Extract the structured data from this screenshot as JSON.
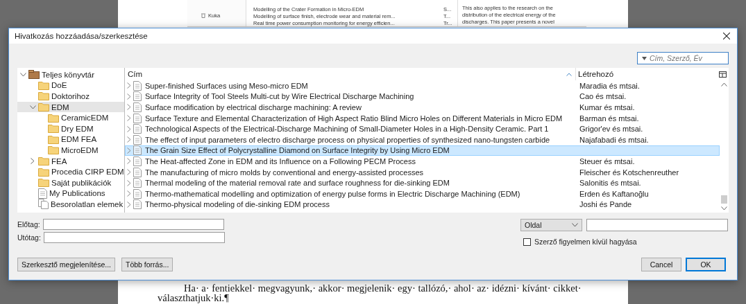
{
  "document": {
    "embedded_screenshot": {
      "sidebar_items": [
        {
          "label": "Kuka",
          "kind": "trash"
        }
      ],
      "rows": [
        {
          "title": "Modelling of the Crater Formation in Micro-EDM",
          "column_2": "S..."
        },
        {
          "title": "Modelling of surface finish, electrode wear and material rem...",
          "column_2": "T..."
        },
        {
          "title": "Real time power consumption monitoring for energy efficien...",
          "column_2": "Tr..."
        }
      ],
      "abstract_lines": [
        "This also applies to the research on the",
        "distribution of the electrical energy of the",
        "discharges. This paper presents a novel"
      ]
    },
    "paragraph_lines": [
      "Ha· a· fentiekkel· megvagyunk,· akkor· megjelenik· egy· tallózó,· ahol· az· idézni· kívánt· cikket·",
      "választhatjuk·ki.¶"
    ]
  },
  "dialog": {
    "title": "Hivatkozás hozzáadása/szerkesztése",
    "search": {
      "placeholder": "Cím, Szerző, Év"
    },
    "tree": [
      {
        "label": "Teljes könyvtár",
        "kind": "library",
        "expanded": true,
        "selected": false,
        "children": [
          {
            "label": "DoE",
            "kind": "folder",
            "selected": false
          },
          {
            "label": "Doktorihoz",
            "kind": "folder",
            "selected": false
          },
          {
            "label": "EDM",
            "kind": "folder",
            "expanded": true,
            "selected": true,
            "children": [
              {
                "label": "CeramicEDM",
                "kind": "folder",
                "selected": false
              },
              {
                "label": "Dry EDM",
                "kind": "folder",
                "selected": false
              },
              {
                "label": "EDM FEA",
                "kind": "folder",
                "selected": false
              },
              {
                "label": "MicroEDM",
                "kind": "folder",
                "selected": false
              }
            ]
          },
          {
            "label": "FEA",
            "kind": "folder",
            "expanded": false,
            "selected": false
          },
          {
            "label": "Procedia CIRP EDM",
            "kind": "folder",
            "selected": false
          },
          {
            "label": "Saját publikációk",
            "kind": "folder",
            "selected": false
          },
          {
            "label": "My Publications",
            "kind": "document",
            "selected": false
          },
          {
            "label": "Besorolatlan elemek",
            "kind": "unfiled",
            "selected": false
          }
        ]
      }
    ],
    "table": {
      "columns": [
        "Cím",
        "Létrehozó"
      ],
      "rows": [
        {
          "title": "Super-finished Surfaces using Meso-micro EDM",
          "creator": "Maradia és mtsai.",
          "selected": false
        },
        {
          "title": "Surface Integrity of Tool Steels Multi-cut by Wire Electrical Discharge Machining",
          "creator": "Cao és mtsai.",
          "selected": false
        },
        {
          "title": "Surface modification by electrical discharge machining: A review",
          "creator": "Kumar és mtsai.",
          "selected": false
        },
        {
          "title": "Surface Texture and Elemental Characterization of High Aspect Ratio Blind Micro Holes on Different Materials in Micro EDM",
          "creator": "Barman és mtsai.",
          "selected": false
        },
        {
          "title": "Technological Aspects of the Electrical-Discharge Machining of Small-Diameter Holes in a High-Density Ceramic. Part 1",
          "creator": "Grigor'ev és mtsai.",
          "selected": false
        },
        {
          "title": "The effect of input parameters of electro discharge process on physical properties of synthesized nano-tungsten carbide",
          "creator": "Najafabadi és mtsai.",
          "selected": false
        },
        {
          "title": "The Grain Size Effect of Polycrystalline Diamond on Surface Integrity by Using Micro EDM",
          "selected": true
        },
        {
          "title": "The Heat-affected Zone in EDM and its Influence on a Following PECM Process",
          "creator": "Steuer és mtsai.",
          "selected": false
        },
        {
          "title": "The manufacturing of micro molds by conventional and energy-assisted processes",
          "creator": "Fleischer és Kotschenreuther",
          "selected": false
        },
        {
          "title": "Thermal modeling of the material removal rate and surface roughness for die-sinking EDM",
          "creator": "Salonitis és mtsai.",
          "selected": false
        },
        {
          "title": "Thermo-mathematical modelling and optimization of energy pulse forms in Electric Discharge Machining (EDM)",
          "creator": "Erden és Kaftanoğlu",
          "selected": false
        },
        {
          "title": "Thermo-physical modeling of die-sinking EDM process",
          "creator": "Joshi és Pande",
          "selected": false
        }
      ]
    },
    "prefix": {
      "label": "Előtag:"
    },
    "suffix": {
      "label": "Utótag:"
    },
    "locator": {
      "value": "Oldal"
    },
    "omit_author": {
      "label": "Szerző figyelmen kívül hagyása",
      "checked": false
    },
    "buttons_left": [
      "Szerkesztő megjelenítése...",
      "Több forrás..."
    ],
    "buttons_right": [
      {
        "label": "Cancel",
        "default": false
      },
      {
        "label": "OK",
        "default": true
      }
    ]
  }
}
